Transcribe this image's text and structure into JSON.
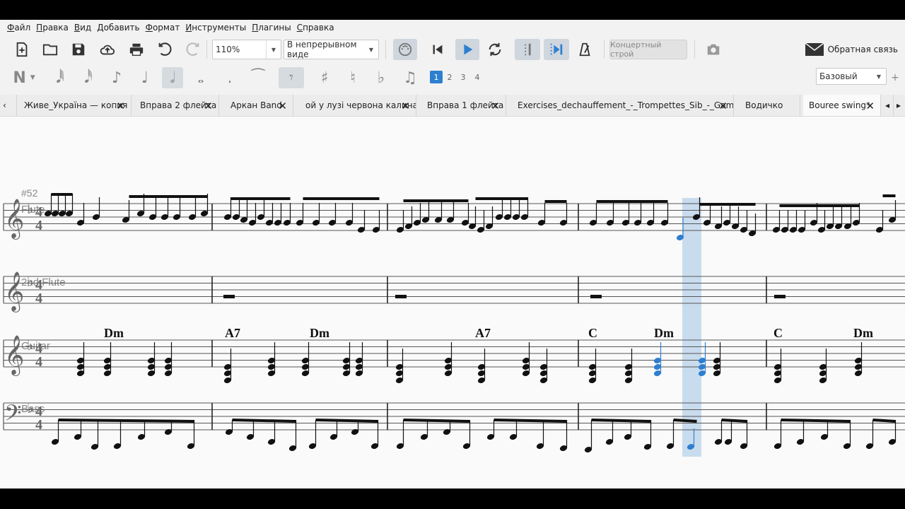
{
  "menu": [
    "Файл",
    "Правка",
    "Вид",
    "Добавить",
    "Формат",
    "Инструменты",
    "Плагины",
    "Справка"
  ],
  "toolbar": {
    "zoom_value": "110%",
    "view_mode": "В непрерывном виде",
    "concert_pitch_label": "Концертный строй",
    "feedback_label": "Обратная связь",
    "workspace": "Базовый",
    "voices": [
      "1",
      "2",
      "3",
      "4"
    ]
  },
  "tabs": [
    {
      "label": "Живе_Україна — копия"
    },
    {
      "label": "Вправа 2 флейта"
    },
    {
      "label": "Аркан Band"
    },
    {
      "label": "ой у лузі червона калина"
    },
    {
      "label": "Вправа 1 флейта"
    },
    {
      "label": "Exercises_dechauffement_-_Trompettes_Sib_-_Gammes*"
    },
    {
      "label": "Водичко"
    },
    {
      "label": "Bouree swing*"
    }
  ],
  "score": {
    "measure_number": "#52",
    "staves": [
      "Flute",
      "2nd Flute",
      "Guitar",
      "Bass"
    ],
    "chords": [
      "Dm",
      "A7",
      "Dm",
      "A7",
      "C",
      "Dm",
      "C",
      "Dm"
    ],
    "colors": {
      "selection": "#2f7fd0",
      "highlight": "#c9dcee"
    }
  }
}
